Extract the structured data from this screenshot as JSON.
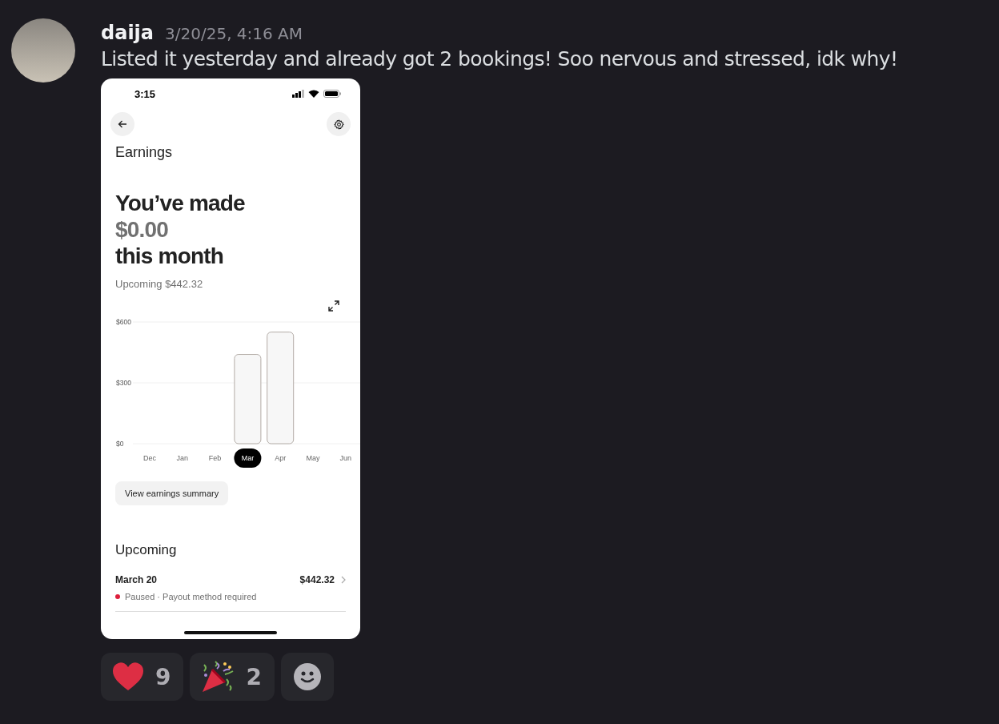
{
  "message": {
    "author": "daija",
    "timestamp": "3/20/25, 4:16 AM",
    "text": "Listed it yesterday and already got 2 bookings! Soo nervous and stressed, idk why!"
  },
  "screenshot": {
    "status_bar": {
      "time": "3:15"
    },
    "title": "Earnings",
    "headline": [
      "You’ve made",
      "$0.00",
      "this month"
    ],
    "upcoming_total": "Upcoming $442.32",
    "chart": {
      "chart_data": {
        "type": "bar",
        "categories": [
          "Dec",
          "Jan",
          "Feb",
          "Mar",
          "Apr",
          "May",
          "Jun"
        ],
        "values": [
          null,
          null,
          null,
          440,
          550,
          null,
          null
        ],
        "ylim": [
          0,
          600
        ],
        "yticks": [
          {
            "value": 0,
            "label": "$0"
          },
          {
            "value": 300,
            "label": "$300"
          },
          {
            "value": 600,
            "label": "$600"
          }
        ]
      },
      "months": [
        {
          "selected": false
        },
        {
          "selected": false
        },
        {
          "selected": false
        },
        {
          "selected": true
        },
        {
          "selected": false
        },
        {
          "selected": false
        },
        {
          "selected": false
        }
      ]
    },
    "summary_button": "View earnings summary",
    "upcoming_heading": "Upcoming",
    "payouts": [
      {
        "date": "March 20",
        "amount": "$442.32",
        "status": "Paused · Payout method required",
        "color": "#dd1f3c"
      }
    ]
  },
  "reactions": [
    {
      "kind": "heart",
      "count": "9"
    },
    {
      "kind": "party",
      "count": "2"
    }
  ]
}
